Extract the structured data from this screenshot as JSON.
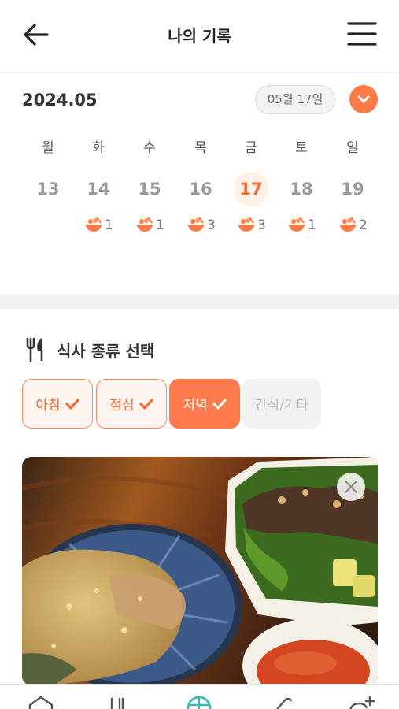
{
  "header": {
    "title": "나의 기록",
    "back_icon": "arrow-left-icon",
    "menu_icon": "hamburger-menu-icon"
  },
  "calendar": {
    "month": "2024.05",
    "selected_date": "05월 17일",
    "dropdown_icon": "chevron-down-icon",
    "weekdays": [
      "월",
      "화",
      "수",
      "목",
      "금",
      "토",
      "일"
    ],
    "days": [
      {
        "num": "13",
        "count": ""
      },
      {
        "num": "14",
        "count": "1"
      },
      {
        "num": "15",
        "count": "1"
      },
      {
        "num": "16",
        "count": "3"
      },
      {
        "num": "17",
        "count": "3"
      },
      {
        "num": "18",
        "count": "1"
      },
      {
        "num": "19",
        "count": "2"
      }
    ],
    "selected_index": 4,
    "meal_icon": "food-bowl-icon"
  },
  "meal_type": {
    "title": "식사 종류 선택",
    "title_icon": "fork-knife-icon",
    "options": [
      {
        "label": "아침",
        "state": "checked"
      },
      {
        "label": "점심",
        "state": "checked"
      },
      {
        "label": "저녁",
        "state": "active"
      },
      {
        "label": "간식/기타",
        "state": "disabled"
      }
    ]
  },
  "photo": {
    "close_icon": "close-icon"
  },
  "bottom_nav": {
    "items": [
      "home-icon",
      "food-log-icon",
      "globe-icon",
      "tag-icon",
      "add-user-icon"
    ]
  },
  "colors": {
    "accent": "#ff7a4d",
    "accent_light": "#fff0e8",
    "gray_text": "#999999"
  }
}
